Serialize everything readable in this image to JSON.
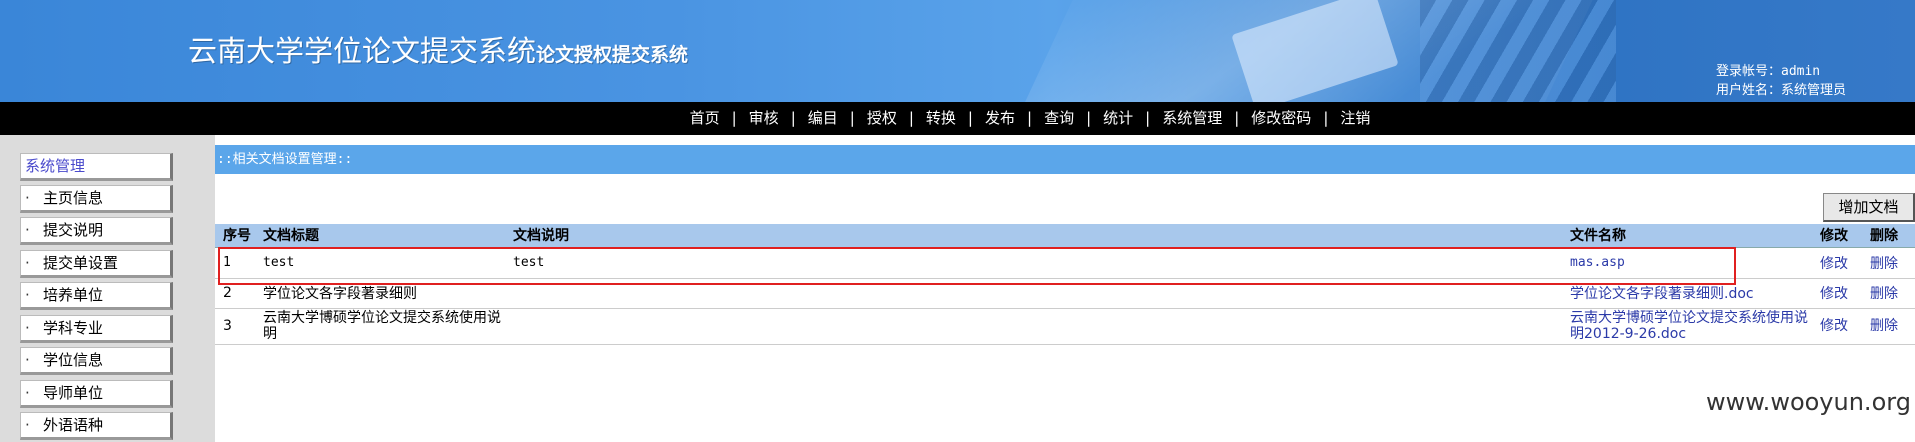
{
  "header": {
    "title": "云南大学学位论文提交系统",
    "subtitle": "论文授权提交系统",
    "login_account": "登录帐号：admin",
    "user_name": "用户姓名：系统管理员"
  },
  "nav": {
    "items": [
      "首页",
      "审核",
      "编目",
      "授权",
      "转换",
      "发布",
      "查询",
      "统计",
      "系统管理",
      "修改密码",
      "注销"
    ],
    "separator": "|"
  },
  "sidebar": {
    "heading": "系统管理",
    "bullet": "·",
    "items": [
      "主页信息",
      "提交说明",
      "提交单设置",
      "培养单位",
      "学科专业",
      "学位信息",
      "导师单位",
      "外语语种"
    ]
  },
  "main": {
    "section_title": "::相关文档设置管理::",
    "add_button": "增加文档",
    "table": {
      "columns": [
        "序号",
        "文档标题",
        "文档说明",
        "文件名称",
        "修改",
        "删除"
      ],
      "rows": [
        {
          "no": "1",
          "title": "test",
          "desc": "test",
          "file": "mas.asp",
          "edit": "修改",
          "delete": "删除"
        },
        {
          "no": "2",
          "title": "学位论文各字段著录细则",
          "desc": "",
          "file": "学位论文各字段著录细则.doc",
          "edit": "修改",
          "delete": "删除"
        },
        {
          "no": "3",
          "title": "云南大学博硕学位论文提交系统使用说明",
          "desc": "",
          "file": "云南大学博硕学位论文提交系统使用说明2012-9-26.doc",
          "edit": "修改",
          "delete": "删除"
        }
      ]
    }
  },
  "watermark": "www.wooyun.org",
  "colors": {
    "header_blue": "#3a86d8",
    "nav_black": "#000000",
    "section_bar": "#5ba6ea",
    "table_header": "#a8c8ec",
    "link": "#2b3aa8",
    "highlight_red": "#e02020"
  }
}
